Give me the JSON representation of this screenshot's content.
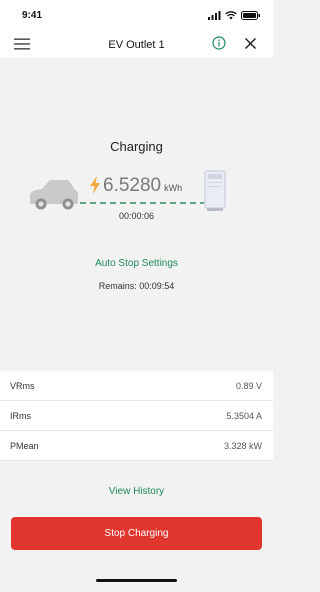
{
  "status_bar": {
    "time": "9:41"
  },
  "nav": {
    "title": "EV Outlet 1"
  },
  "charging": {
    "title": "Charging",
    "energy_value": "6.5280",
    "energy_unit": "kWh",
    "elapsed": "00:00:06",
    "auto_stop_label": "Auto Stop Settings",
    "remains": "Remains: 00:09:54"
  },
  "readings": [
    {
      "label": "VRms",
      "value": "0.89 V"
    },
    {
      "label": "IRms",
      "value": "5.3504 A"
    },
    {
      "label": "PMean",
      "value": "3.328 kW"
    }
  ],
  "view_history_label": "View History",
  "stop_button_label": "Stop Charging",
  "colors": {
    "accent": "#1f8a5a",
    "danger": "#e0362e",
    "bolt": "#f2a93b"
  },
  "icons": [
    "signal-icon",
    "wifi-icon",
    "battery-icon",
    "menu-icon",
    "info-icon",
    "close-icon",
    "car-icon",
    "bolt-icon",
    "charger-icon"
  ]
}
